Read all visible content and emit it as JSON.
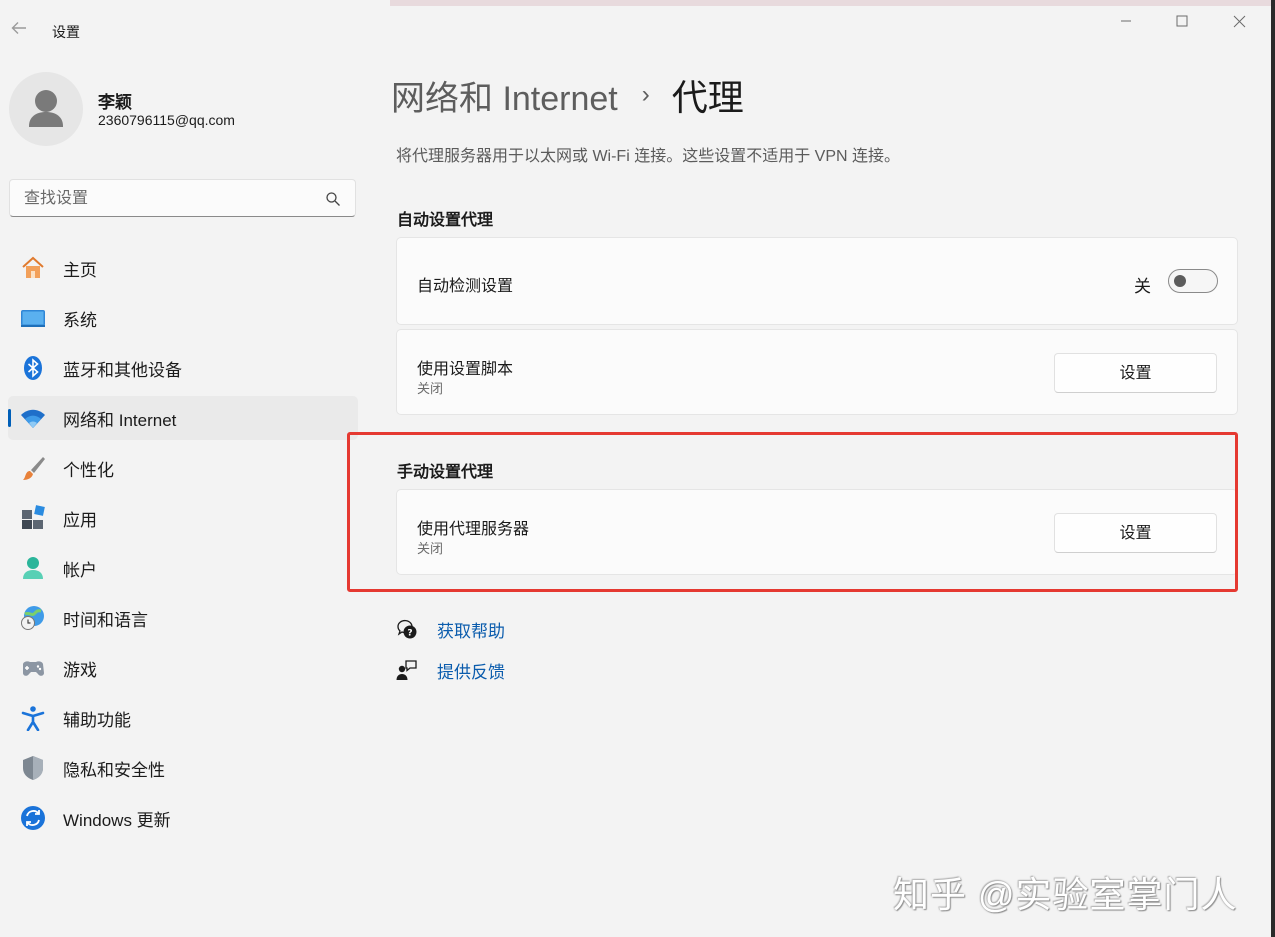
{
  "window": {
    "app_title": "设置",
    "controls": {
      "minimize": "minimize-icon",
      "maximize": "maximize-icon",
      "close": "close-icon"
    }
  },
  "profile": {
    "name": "李颖",
    "email": "2360796115@qq.com"
  },
  "search": {
    "placeholder": "查找设置"
  },
  "sidebar": {
    "items": [
      {
        "label": "主页",
        "icon": "home-icon"
      },
      {
        "label": "系统",
        "icon": "system-icon"
      },
      {
        "label": "蓝牙和其他设备",
        "icon": "bluetooth-icon"
      },
      {
        "label": "网络和 Internet",
        "icon": "wifi-icon",
        "selected": true
      },
      {
        "label": "个性化",
        "icon": "brush-icon"
      },
      {
        "label": "应用",
        "icon": "apps-icon"
      },
      {
        "label": "帐户",
        "icon": "account-icon"
      },
      {
        "label": "时间和语言",
        "icon": "time-language-icon"
      },
      {
        "label": "游戏",
        "icon": "gamepad-icon"
      },
      {
        "label": "辅助功能",
        "icon": "accessibility-icon"
      },
      {
        "label": "隐私和安全性",
        "icon": "shield-icon"
      },
      {
        "label": "Windows 更新",
        "icon": "update-icon"
      }
    ]
  },
  "breadcrumb": {
    "parent": "网络和 Internet",
    "separator": "›",
    "current": "代理"
  },
  "description": "将代理服务器用于以太网或 Wi-Fi 连接。这些设置不适用于 VPN 连接。",
  "auto_section": {
    "title": "自动设置代理",
    "detect": {
      "label": "自动检测设置",
      "state_label": "关",
      "on": false
    },
    "script": {
      "label": "使用设置脚本",
      "status": "关闭",
      "button": "设置"
    }
  },
  "manual_section": {
    "title": "手动设置代理",
    "proxy": {
      "label": "使用代理服务器",
      "status": "关闭",
      "button": "设置"
    }
  },
  "links": {
    "help": "获取帮助",
    "feedback": "提供反馈"
  },
  "watermark": "知乎 @实验室掌门人",
  "colors": {
    "accent": "#005fb8",
    "highlight_box": "#e53931",
    "link": "#0b5cad"
  }
}
